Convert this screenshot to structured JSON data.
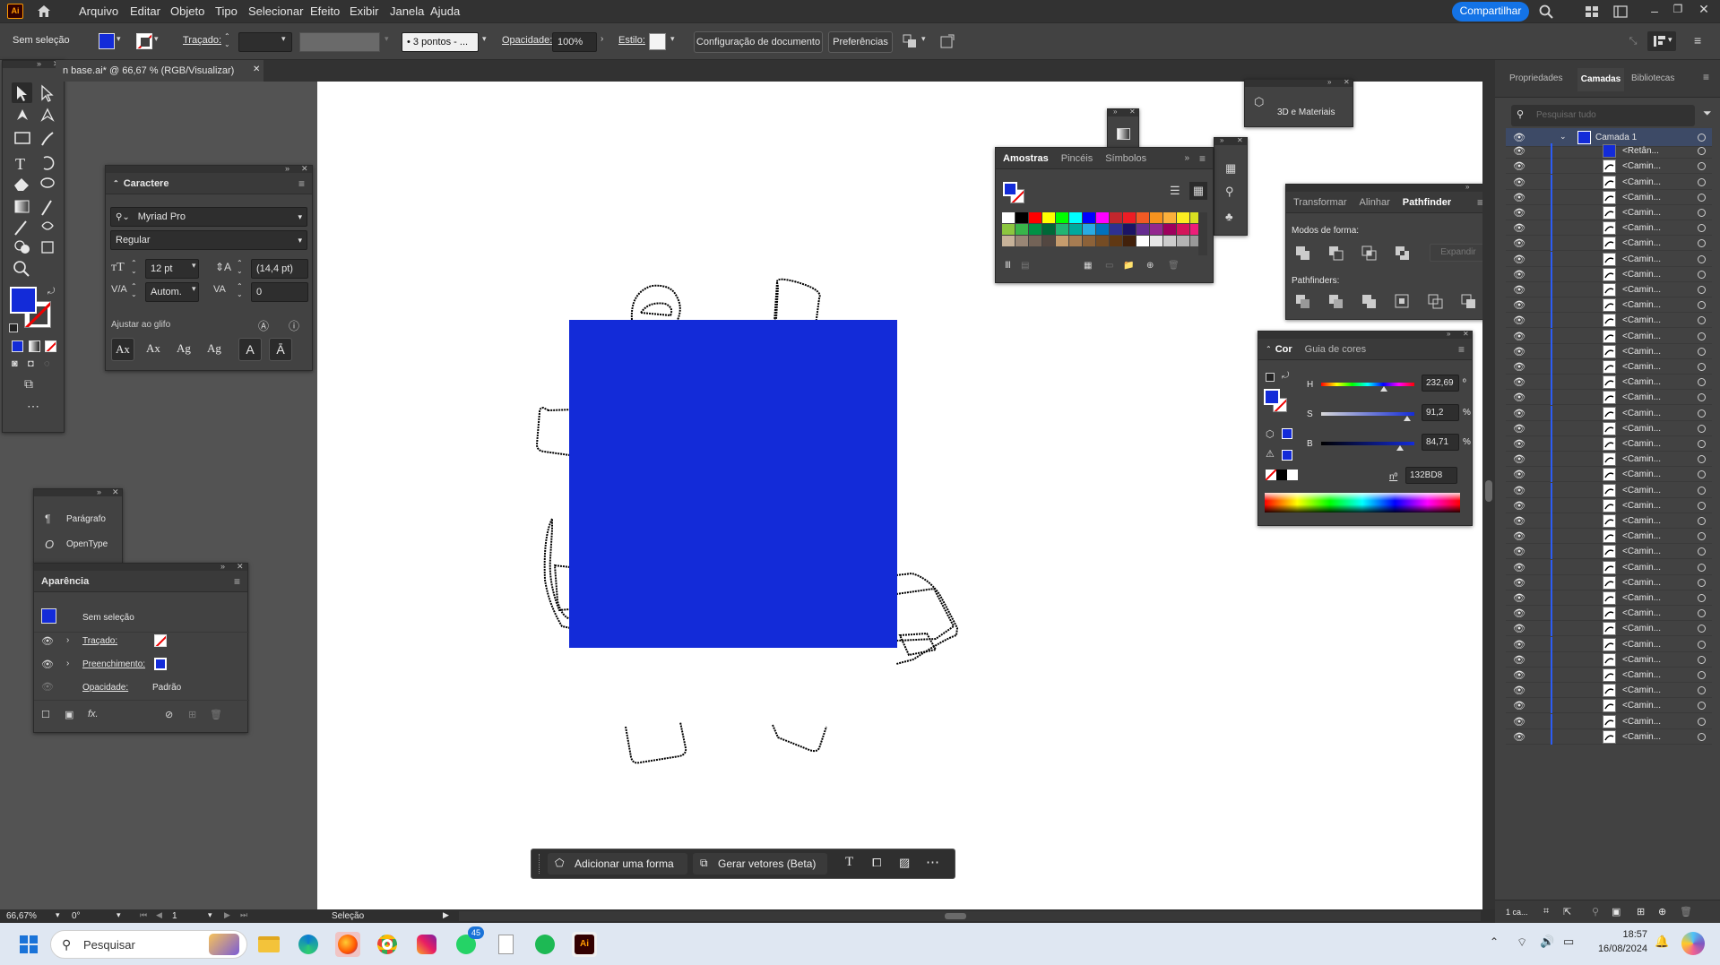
{
  "app": {
    "logo": "Ai",
    "share_label": "Compartilhar"
  },
  "menu": [
    "Arquivo",
    "Editar",
    "Objeto",
    "Tipo",
    "Selecionar",
    "Efeito",
    "Exibir",
    "Janela",
    "Ajuda"
  ],
  "options": {
    "selection": "Sem seleção",
    "stroke_label": "Traçado:",
    "brush": "3 pontos - ...",
    "opacity_label": "Opacidade:",
    "opacity_value": "100%",
    "style_label": "Estilo:",
    "doc_setup": "Configuração de documento",
    "prefs": "Preferências"
  },
  "document": {
    "tab_title": "n base.ai* @ 66,67 % (RGB/Visualizar)"
  },
  "colors": {
    "fill": "#132BD8",
    "ui_dark": "#323232"
  },
  "character": {
    "title": "Caractere",
    "font": "Myriad Pro",
    "style": "Regular",
    "size": "12 pt",
    "leading": "(14,4 pt)",
    "kerning": "Autom.",
    "tracking": "0",
    "snap": "Ajustar ao glifo"
  },
  "paragraph": {
    "p1": "Parágrafo",
    "p2": "OpenType"
  },
  "appearance": {
    "title": "Aparência",
    "none": "Sem seleção",
    "stroke": "Traçado:",
    "fill": "Preenchimento:",
    "opacity": "Opacidade:",
    "opacity_val": "Padrão"
  },
  "swatches": {
    "tabs": [
      "Amostras",
      "Pincéis",
      "Símbolos"
    ]
  },
  "materials": {
    "label": "3D e Materiais"
  },
  "pathfinder": {
    "tabs": [
      "Transformar",
      "Alinhar",
      "Pathfinder"
    ],
    "shape_modes": "Modos de forma:",
    "expand": "Expandir",
    "pathfinders": "Pathfinders:"
  },
  "color": {
    "tabs": [
      "Cor",
      "Guia de cores"
    ],
    "h_label": "H",
    "h_value": "232,69",
    "h_unit": "º",
    "s_label": "S",
    "s_value": "91,2",
    "s_unit": "%",
    "b_label": "B",
    "b_value": "84,71",
    "b_unit": "%",
    "hex_label": "nº",
    "hex_value": "132BD8"
  },
  "layers": {
    "tabs": [
      "Propriedades",
      "Camadas",
      "Bibliotecas"
    ],
    "search": "Pesquisar tudo",
    "layer_name": "Camada 1",
    "first_item": "<Retân...",
    "item": "<Camin...",
    "footer": "1 ca..."
  },
  "status": {
    "zoom": "66,67%",
    "rotation": "0°",
    "artboard": "1",
    "tool": "Seleção"
  },
  "context_bar": {
    "add_shape": "Adicionar uma forma",
    "vectors": "Gerar vetores (Beta)"
  },
  "taskbar": {
    "search": "Pesquisar",
    "time": "18:57",
    "date": "16/08/2024",
    "badge": "45"
  }
}
